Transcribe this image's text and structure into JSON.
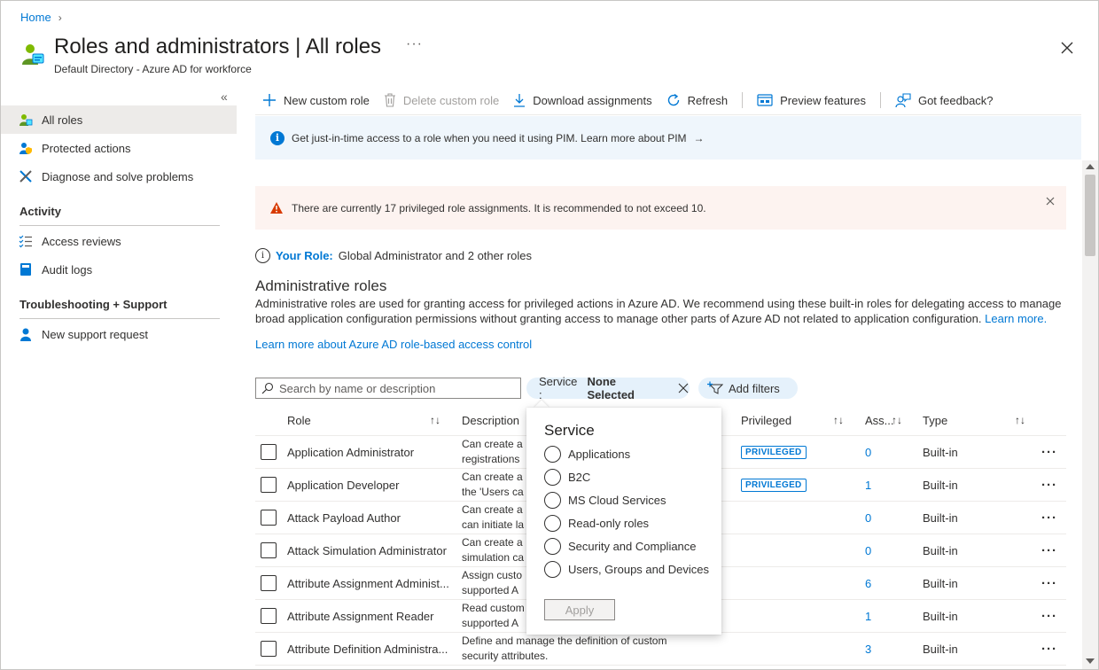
{
  "breadcrumb": {
    "home": "Home"
  },
  "header": {
    "title": "Roles and administrators | All roles",
    "subtitle": "Default Directory - Azure AD for workforce",
    "more": "···"
  },
  "sidebar": {
    "collapse": "«",
    "items": [
      {
        "label": "All roles",
        "icon": "roles-icon"
      },
      {
        "label": "Protected actions",
        "icon": "protected-actions-icon"
      },
      {
        "label": "Diagnose and solve problems",
        "icon": "tools-icon"
      }
    ],
    "activity": {
      "title": "Activity",
      "items": [
        {
          "label": "Access reviews",
          "icon": "checklist-icon"
        },
        {
          "label": "Audit logs",
          "icon": "book-icon"
        }
      ]
    },
    "support": {
      "title": "Troubleshooting + Support",
      "items": [
        {
          "label": "New support request",
          "icon": "person-support-icon"
        }
      ]
    }
  },
  "toolbar": {
    "new_custom_role": "New custom role",
    "delete_custom_role": "Delete custom role",
    "download_assignments": "Download assignments",
    "refresh": "Refresh",
    "preview_features": "Preview features",
    "feedback": "Got feedback?"
  },
  "info_banner": {
    "text": "Get just-in-time access to a role when you need it using PIM. Learn more about PIM",
    "arrow": "→"
  },
  "warning_banner": {
    "text": "There are currently 17 privileged role assignments. It is recommended to not exceed 10."
  },
  "your_role": {
    "label": "Your Role:",
    "value": "Global Administrator and 2 other roles"
  },
  "admin_roles": {
    "title": "Administrative roles",
    "description": "Administrative roles are used for granting access for privileged actions in Azure AD. We recommend using these built-in roles for delegating access to manage broad application configuration permissions without granting access to manage other parts of Azure AD not related to application configuration.",
    "learn_more": "Learn more.",
    "learn_rbac": "Learn more about Azure AD role-based access control"
  },
  "filters": {
    "search_placeholder": "Search by name or description",
    "service_label": "Service : ",
    "service_value": "None Selected",
    "add_filters": "Add filters"
  },
  "table": {
    "headers": {
      "role": "Role",
      "description": "Description",
      "privileged": "Privileged",
      "assignments": "Ass...",
      "type": "Type"
    },
    "rows": [
      {
        "role": "Application Administrator",
        "desc1": "Can create a",
        "desc2": "registrations",
        "privileged": "PRIVILEGED",
        "assignments": "0",
        "type": "Built-in"
      },
      {
        "role": "Application Developer",
        "desc1": "Can create a",
        "desc2": "the 'Users ca",
        "privileged": "PRIVILEGED",
        "assignments": "1",
        "type": "Built-in"
      },
      {
        "role": "Attack Payload Author",
        "desc1": "Can create a",
        "desc2": "can initiate la",
        "privileged": "",
        "assignments": "0",
        "type": "Built-in"
      },
      {
        "role": "Attack Simulation Administrator",
        "desc1": "Can create a",
        "desc2": "simulation ca",
        "privileged": "",
        "assignments": "0",
        "type": "Built-in"
      },
      {
        "role": "Attribute Assignment Administ...",
        "desc1": "Assign custo",
        "desc2": "supported A",
        "privileged": "",
        "assignments": "6",
        "type": "Built-in"
      },
      {
        "role": "Attribute Assignment Reader",
        "desc1": "Read custom",
        "desc2": "supported A",
        "privileged": "",
        "assignments": "1",
        "type": "Built-in"
      },
      {
        "role": "Attribute Definition Administra...",
        "desc1": "Define and manage the definition of custom",
        "desc2": "security attributes.",
        "privileged": "",
        "assignments": "3",
        "type": "Built-in"
      }
    ]
  },
  "service_popup": {
    "title": "Service",
    "options": [
      "Applications",
      "B2C",
      "MS Cloud Services",
      "Read-only roles",
      "Security and Compliance",
      "Users, Groups and Devices"
    ],
    "apply": "Apply"
  },
  "colors": {
    "accent": "#0078d4",
    "info_bg": "#eff6fc",
    "warning_bg": "#fdf3f0",
    "warning_icon": "#d83b01",
    "selected_nav": "#edebe9",
    "pill_bg": "#e5f1fb"
  }
}
